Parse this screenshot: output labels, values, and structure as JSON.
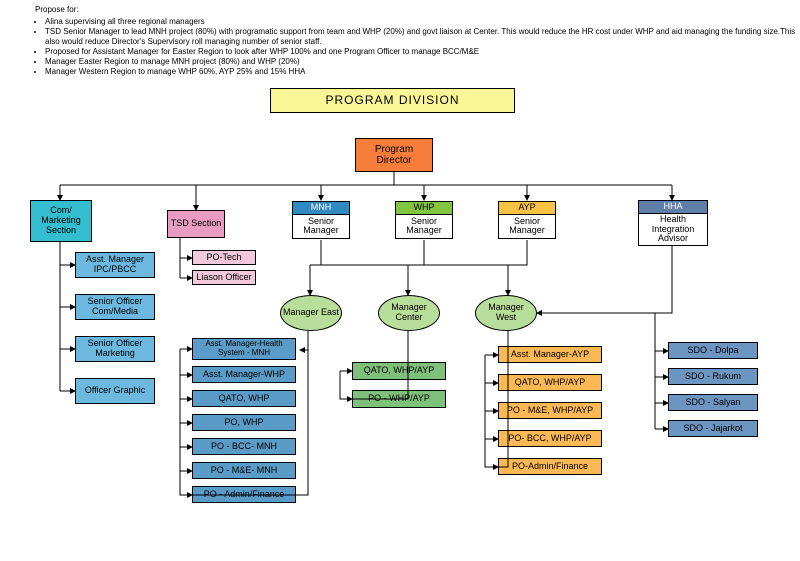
{
  "propose_title": "Propose for:",
  "propose_items": [
    "Alina supervising all three regional managers",
    "TSD Senior Manager to lead MNH project (80%) with programatic support from team and WHP (20%) and govt liaison at Center. This would reduce the HR cost under WHP and aid managing the funding size.This also would reduce Director's Supervisory roll managing number of senior staff.",
    "Proposed for Assistant Manager for Easter Region to look after WHP 100% and one Program Officer to manage BCC/M&E",
    "Manager Easter Region to manage MNH project (80%) and WHP (20%)",
    "Manager Western Region to manage WHP 60%, AYP 25% and 15% HHA"
  ],
  "banner": "PROGRAM DIVISION",
  "director": {
    "line1": "Program",
    "line2": "Director"
  },
  "com": {
    "title": "Com/ Marketing Section",
    "items": [
      "Asst. Manager IPC/PBCC",
      "Senior Officer Com/Media",
      "Senior Officer Marketing",
      "Officer Graphic"
    ]
  },
  "tsd": {
    "title": "TSD Section",
    "items": [
      "PO-Tech",
      "Liason Officer"
    ]
  },
  "mnh": {
    "head": "MNH",
    "sub": "Senior Manager"
  },
  "whp": {
    "head": "WHP",
    "sub": "Senior Manager"
  },
  "ayp": {
    "head": "AYP",
    "sub": "Senior Manager"
  },
  "hha": {
    "head": "HHA",
    "sub": "Health Integration Advisor"
  },
  "mgr_east": "Manager East",
  "mgr_center": "Manager Center",
  "mgr_west": "Manager West",
  "east_items": [
    "Asst. Manager-Health System - MNH",
    "Asst. Manager-WHP",
    "QATO, WHP",
    "PO, WHP",
    "PO - BCC- MNH",
    "PO - M&E- MNH",
    "PO - Admin/Finance"
  ],
  "center_items": [
    "QATO, WHP/AYP",
    "PO - WHP/AYP"
  ],
  "west_items": [
    "Asst. Manager-AYP",
    "QATO, WHP/AYP",
    "PO - M&E, WHP/AYP",
    "PO- BCC, WHP/AYP",
    "PO-Admin/Finance"
  ],
  "sdo_items": [
    "SDO - Dolpa",
    "SDO - Rukum",
    "SDO - Salyan",
    "SDO - Jajarkot"
  ]
}
